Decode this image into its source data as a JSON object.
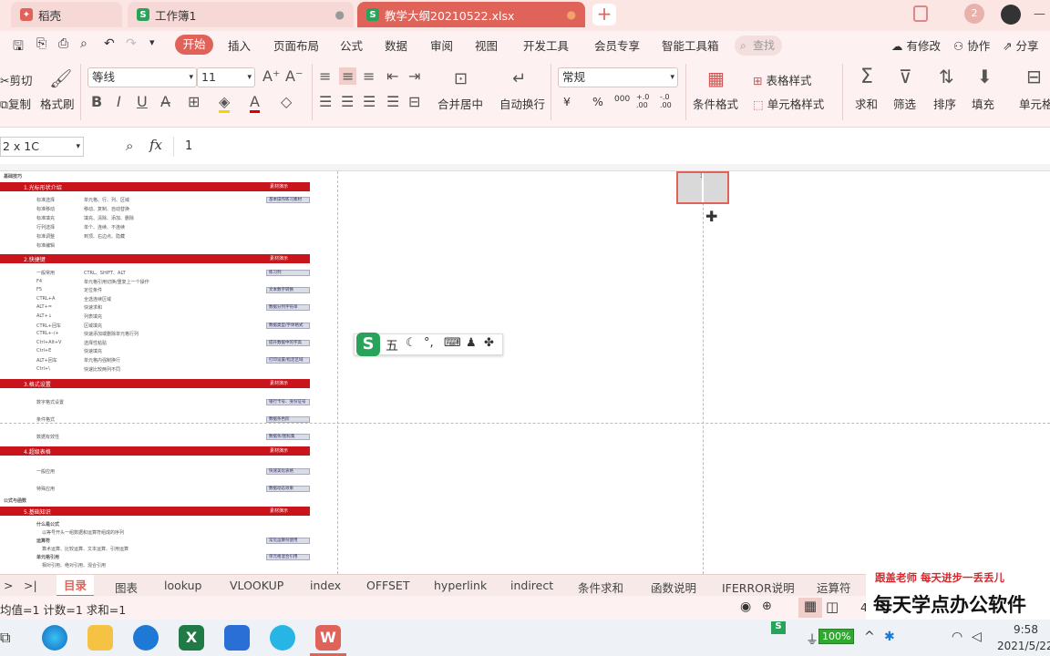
{
  "titlebar": {
    "tabs": [
      {
        "label": "稻壳",
        "icon": "wps-logo-icon",
        "color": "#e0635a"
      },
      {
        "label": "工作簿1",
        "icon": "spreadsheet-icon",
        "color": "#29a35a"
      },
      {
        "label": "教学大纲20210522.xlsx",
        "icon": "spreadsheet-icon",
        "color": "#29a35a"
      }
    ],
    "new_tab": "+",
    "badge": "2"
  },
  "menubar": {
    "items": [
      "开始",
      "插入",
      "页面布局",
      "公式",
      "数据",
      "审阅",
      "视图",
      "开发工具",
      "会员专享",
      "智能工具箱"
    ],
    "search_placeholder": "查找",
    "right": [
      "有修改",
      "协作",
      "分享"
    ]
  },
  "ribbon": {
    "cut": "剪切",
    "copy": "复制",
    "format_painter": "格式刷",
    "font_name": "等线",
    "font_size": "11",
    "merge_center": "合并居中",
    "wrap_text": "自动换行",
    "number_format": "常规",
    "currency": "¥",
    "percent": "%",
    "thousands": "000",
    "inc_decimal": "+.0 .00",
    "dec_decimal": "-.0 .00",
    "conditional_format": "条件格式",
    "table_style": "表格样式",
    "cell_style": "单元格样式",
    "sum": "求和",
    "filter": "筛选",
    "sort": "排序",
    "fill": "填充",
    "cell": "单元格"
  },
  "formulabar": {
    "name_box": "2 x 1C",
    "fx": "fx",
    "value": "1"
  },
  "sheet": {
    "title_a": "基础技巧",
    "sections": [
      {
        "title": "1.光标形状介绍",
        "tag": "素材演示"
      },
      {
        "title": "2.快捷键",
        "tag": "素材演示"
      },
      {
        "title": "3.格式设置",
        "tag": "素材演示"
      },
      {
        "title": "4.超级表格",
        "tag": "素材演示"
      },
      {
        "title": "5.基础知识",
        "tag": "素材演示"
      }
    ],
    "section1_rows": [
      [
        "标准选择",
        "单元格、行、列、区域",
        "基本操作练习素材"
      ],
      [
        "标准移动",
        "移动、复制、自动替换",
        ""
      ],
      [
        "标准填充",
        "填充、清除、添加、删除",
        ""
      ],
      [
        "行列选择",
        "单个、连续、不连续",
        ""
      ],
      [
        "标准调整",
        "到顶、右边点、隐藏",
        ""
      ],
      [
        "标准编辑",
        "",
        ""
      ]
    ],
    "section2_rows": [
      [
        "一般常用",
        "CTRL、SHIFT、ALT",
        "练习列"
      ],
      [
        "F4",
        "单元格引用切换/重复上一个操作",
        ""
      ],
      [
        "F5",
        "定位条件",
        "文本数字转换"
      ],
      [
        "CTRL+A",
        "全选连续区域",
        ""
      ],
      [
        "ALT+=",
        "快速求和",
        "数据分列字符串"
      ],
      [
        "ALT+↓",
        "列表填充",
        ""
      ],
      [
        "CTRL+回车",
        "区域填充",
        "数据类型/字体格式"
      ],
      [
        "CTRL+-/+",
        "快速添加或删除单元格行列",
        ""
      ],
      [
        "Ctrl+Alt+V",
        "选择性粘贴",
        "提升数据中的字高"
      ],
      [
        "Ctrl+E",
        "快速填充",
        ""
      ],
      [
        "ALT+回车",
        "单元格内强制换行",
        "打印设置/指定区域"
      ],
      [
        "Ctrl+\\",
        "快速比较两列不同",
        ""
      ]
    ],
    "section3_rows": [
      [
        "数字格式设置",
        "银行卡号、身份证号"
      ],
      [
        "条件格式",
        "数据条色阶"
      ],
      [
        "数据有效性",
        "数据条/图标集"
      ]
    ],
    "section4_rows": [
      [
        "一般应用",
        "快速美化表格"
      ],
      [
        "特殊应用",
        "数据动态效果"
      ]
    ],
    "title_b": "公式与函数",
    "section5_rows": [
      [
        "什么是公式",
        "",
        ""
      ],
      [
        "",
        "以等号开头一组数据和运算符组成的序列",
        ""
      ],
      [
        "运算符",
        "",
        "常见运算符使用"
      ],
      [
        "",
        "算术运算、比较运算、文本运算、引用运算",
        ""
      ],
      [
        "单元格引用",
        "",
        "单元格混合引用"
      ],
      [
        "",
        "相对引用、绝对引用、混合引用",
        ""
      ]
    ],
    "selected_cell_value": "1"
  },
  "ime_toolbar": {
    "logo": "S",
    "mode": "五"
  },
  "sheet_tabs": [
    "目录",
    "图表",
    "lookup",
    "VLOOKUP",
    "index",
    "OFFSET",
    "hyperlink",
    "indirect",
    "条件求和",
    "函数说明",
    "IFERROR说明",
    "运算符"
  ],
  "statusbar": {
    "summary": "均值=1  计数=1  求和=1",
    "page": "4"
  },
  "watermark": {
    "line1": "跟盖老师   每天进步一丢丢儿",
    "line2": "每天学点办公软件"
  },
  "taskbar": {
    "battery": "100%",
    "time": "9:58",
    "date": "2021/5/22"
  },
  "colors": {
    "accent": "#e0635a",
    "section_red": "#c8141a"
  }
}
